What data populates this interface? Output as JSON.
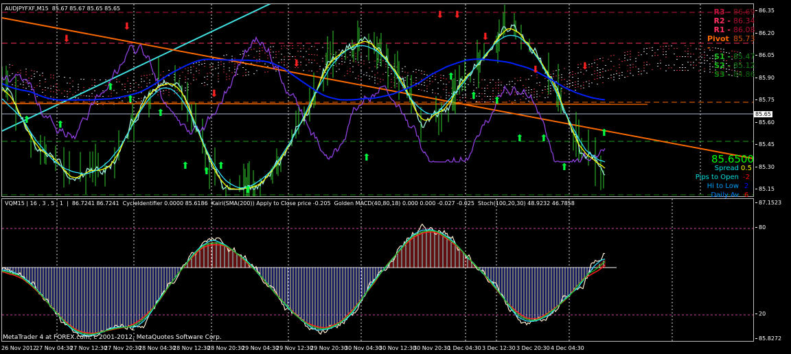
{
  "main_chart": {
    "header": "AUDJPYFXF,M15  85.67 85.67 85.65 85.65",
    "price_axis": [
      "86.35",
      "86.20",
      "86.05",
      "85.90",
      "85.75",
      "85.60",
      "85.45",
      "85.30",
      "85.15"
    ],
    "current_price": "85.65",
    "pivots": [
      {
        "label": "R3 -",
        "value": "86.69",
        "label_color": "#c0143c",
        "value_color": "#8b1020"
      },
      {
        "label": "R2 -",
        "value": "86.34",
        "label_color": "#ff3060",
        "value_color": "#b01030"
      },
      {
        "label": "R1 -",
        "value": "86.08",
        "label_color": "#ff3060",
        "value_color": "#b01030"
      },
      {
        "label": "Pivot -",
        "value": "85.73",
        "label_color": "#ff6a00",
        "value_color": "#d05000"
      },
      {
        "label": "S1 -",
        "value": "85.47",
        "label_color": "#20c020",
        "value_color": "#108010"
      },
      {
        "label": "S2 -",
        "value": "85.12",
        "label_color": "#20c020",
        "value_color": "#108010"
      },
      {
        "label": "S3 -",
        "value": "84.86",
        "label_color": "#108010",
        "value_color": "#0a600a"
      }
    ],
    "info": {
      "price": "85.6500",
      "rows": [
        {
          "label": "Spread",
          "value": "0.5",
          "label_color": "#00e0e0",
          "value_color": "#ffff00"
        },
        {
          "label": "Pips to Open",
          "value": "-2",
          "label_color": "#00e0e0",
          "value_color": "#ff0000"
        },
        {
          "label": "Hi to Low",
          "value": "2",
          "label_color": "#00a0ff",
          "value_color": "#0000ff"
        },
        {
          "label": "Daily Av",
          "value": "6",
          "label_color": "#0080ff",
          "value_color": "#ff0000"
        }
      ]
    }
  },
  "sub_chart": {
    "header": "VQM15 | 16 , 3 , 5 , 1  |  86.7241 86.7241  CycleIdentifier 0.0000 85.6186  Kairi(SMA(200)) Apply to Close price -0.205  Golden MACD(40,80,18) 0.000 0.000 -0.027 -0.025  Stoch(100,20,30) 48.9232 46.7858",
    "axis_top": "87.1523",
    "axis_bottom": "85.8272",
    "level_high": "80",
    "level_low": "20"
  },
  "time_axis": [
    "26 Nov 2012",
    "27 Nov 04:30",
    "27 Nov 12:30",
    "27 Nov 20:30",
    "28 Nov 04:30",
    "28 Nov 12:30",
    "28 Nov 20:30",
    "29 Nov 04:30",
    "29 Nov 12:30",
    "29 Nov 20:30",
    "30 Nov 04:30",
    "30 Nov 12:30",
    "30 Nov 20:30",
    "1 Dec 04:30",
    "3 Dec 12:30",
    "3 Dec 20:30",
    "4 Dec 04:30"
  ],
  "copyright": "MetaTrader 4 at FOREX.com, c 2001-2012, MetaQuotes Software Corp."
}
